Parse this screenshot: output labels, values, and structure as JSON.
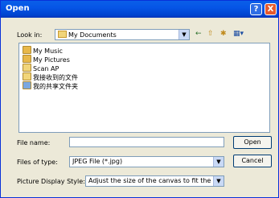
{
  "window": {
    "title": "Open",
    "help_glyph": "?",
    "close_glyph": "X"
  },
  "toolbar": {
    "look_in_label": "Look in:",
    "look_in_value": "My Documents",
    "back_glyph": "←",
    "up_glyph": "⇧",
    "new_folder_glyph": "✱",
    "views_glyph": "▦▾"
  },
  "files": [
    {
      "label": "My Music",
      "icon": "music-folder-icon",
      "color": "#e8b84a"
    },
    {
      "label": "My Pictures",
      "icon": "pictures-folder-icon",
      "color": "#e8b84a"
    },
    {
      "label": "Scan AP",
      "icon": "folder-icon",
      "color": "#f1d57a"
    },
    {
      "label": "我接收到的文件",
      "icon": "folder-icon",
      "color": "#f1d57a"
    },
    {
      "label": "我的共享文件夹",
      "icon": "shared-folder-icon",
      "color": "#7aa7e0"
    }
  ],
  "form": {
    "file_name_label": "File name:",
    "file_name_value": "",
    "files_of_type_label": "Files of type:",
    "files_of_type_value": "JPEG File (*.jpg)",
    "picture_style_label": "Picture Display Style:",
    "picture_style_value": "Adjust the size of the canvas to fit the pictu",
    "open_label": "Open",
    "cancel_label": "Cancel",
    "dropdown_glyph": "▼"
  }
}
